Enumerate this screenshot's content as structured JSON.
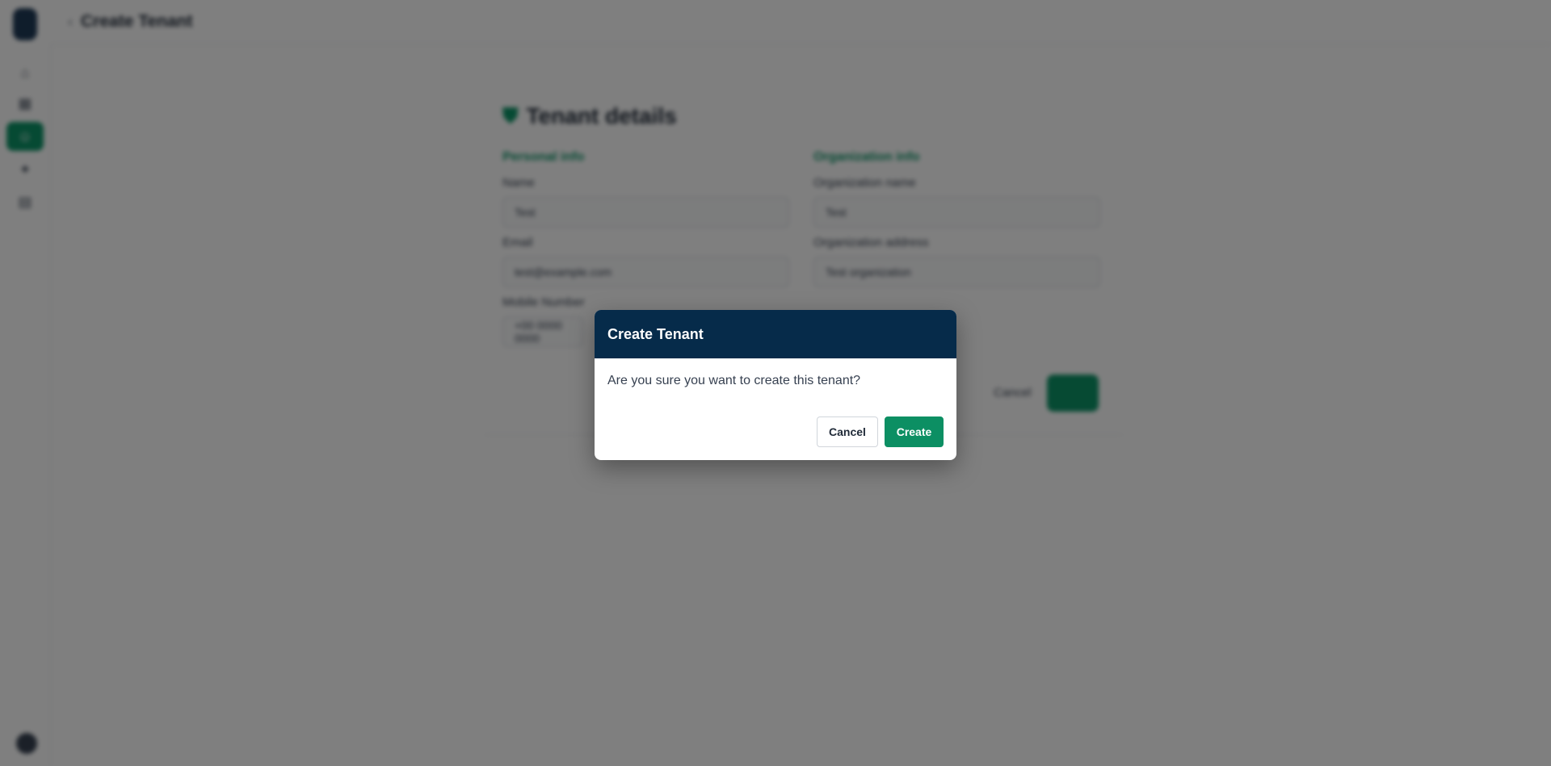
{
  "header": {
    "back_icon": "chevron-left-icon",
    "title": "Create Tenant"
  },
  "sidebar": {
    "items": [
      {
        "icon": "home-icon",
        "active": false
      },
      {
        "icon": "grid-icon",
        "active": false
      },
      {
        "icon": "users-icon",
        "active": true
      },
      {
        "icon": "settings-icon",
        "active": false
      },
      {
        "icon": "building-icon",
        "active": false
      }
    ]
  },
  "form": {
    "title": "Tenant details",
    "title_icon": "shield-icon",
    "sections": {
      "left": "Personal info",
      "right": "Organization info"
    },
    "fields": {
      "name": {
        "label": "Name",
        "value": "Test"
      },
      "email": {
        "label": "Email",
        "value": "test@example.com"
      },
      "mobile": {
        "label": "Mobile Number",
        "value": "+00 0000 0000"
      },
      "org_name": {
        "label": "Organization name",
        "value": "Test"
      },
      "org_address": {
        "label": "Organization address",
        "value": "Test organization"
      }
    },
    "cancel_label": "Cancel"
  },
  "dialog": {
    "title": "Create Tenant",
    "message": "Are you sure you want to create this tenant?",
    "cancel_label": "Cancel",
    "create_label": "Create"
  },
  "colors": {
    "dialog_header": "#062b4a",
    "primary": "#0c8f63",
    "overlay": "rgba(0,0,0,0.5)"
  }
}
